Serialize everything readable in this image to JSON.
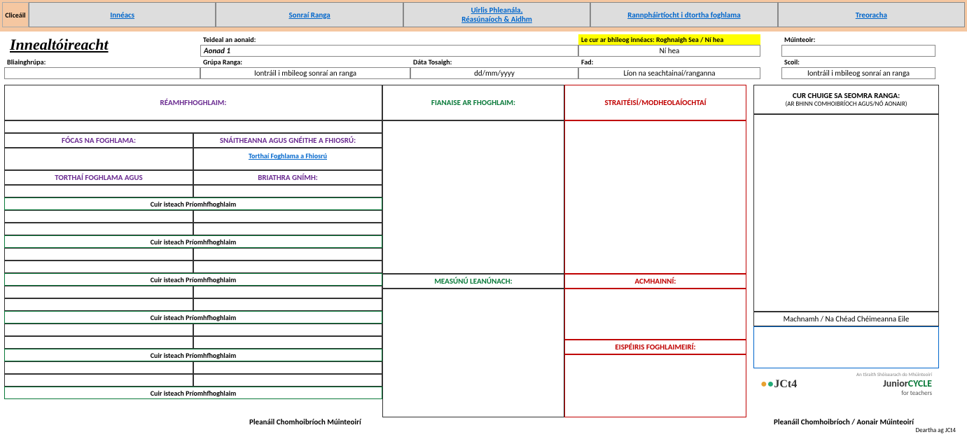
{
  "nav": {
    "click_label": "Cliceáil",
    "tabs": [
      "Innéacs",
      "Sonraí Ranga",
      "Uirlis Phleanála,\nRéasúnaíoch & Aidhm",
      "Rannpháirtíocht i dtortha foghlama",
      "Treoracha"
    ]
  },
  "header": {
    "title": "Innealtóireacht",
    "unit_title_label": "Teideal an aonaid:",
    "unit_title": "Aonad 1",
    "index_prompt": "Le cur ar bhileog innéacs: Roghnaigh Sea / Ní hea",
    "index_value": "Ní hea",
    "teacher_label": "Múinteoir:",
    "year_group_label": "Bliainghrúpa:",
    "class_group_label": "Grúpa Ranga:",
    "class_group_value": "Iontráil i mbileog sonraí an ranga",
    "start_date_label": "Dáta Tosaigh:",
    "start_date_value": "dd/mm/yyyy",
    "duration_label": "Fad:",
    "duration_value": "Líon na seachtainaí/ranganna",
    "school_label": "Scoil:",
    "school_value": "Iontráil i mbileog sonraí an ranga"
  },
  "sections": {
    "prior": "RÉAMHFHOGHLAIM:",
    "focus": "FÓCAS NA FOGHLAMA:",
    "strands": "SNÁITHEANNA AGUS GNÉITHE A FHIOSRÚ:",
    "outcomes_link": "Torthaí Foghlama a Fhiosrú",
    "outcomes": "TORTHAÍ FOGHLAMA  AGUS",
    "verbs": "BRIATHRA GNÍMH:",
    "insert_key": "Cuir isteach Príomhfhoghlaim",
    "evidence": "FIANAISE AR FHOGHLAIM:",
    "ongoing": "MEASÚNÚ LEANÚNACH:",
    "strategies": "STRAITÉISÍ/MODHEOLAÍOCHTAÍ",
    "resources": "ACMHAINNÍ:",
    "experiences": "EISPÉIRIS FOGHLAIMEIRÍ:",
    "approach_title": "CUR CHUIGE SA SEOMRA RANGA:",
    "approach_sub": "(AR BHINN COMHOIBRÍOCH AGUS/NÓ AONAIR)",
    "reflection": "Machnamh / Na Chéad Chéimeanna Eile"
  },
  "footer": {
    "left": "Pleanáil Chomhoibríoch Múinteoirí",
    "right": "Pleanáil Chomhoibríoch / Aonair Múinteoirí",
    "logo1": "JCt4",
    "logo2_top": "An tSraith Shóisearach do Mhúinteoirí",
    "logo2": "JuniorCYCLE",
    "logo2_sub": "for teachers",
    "credit": "Deartha ag JCt4"
  }
}
